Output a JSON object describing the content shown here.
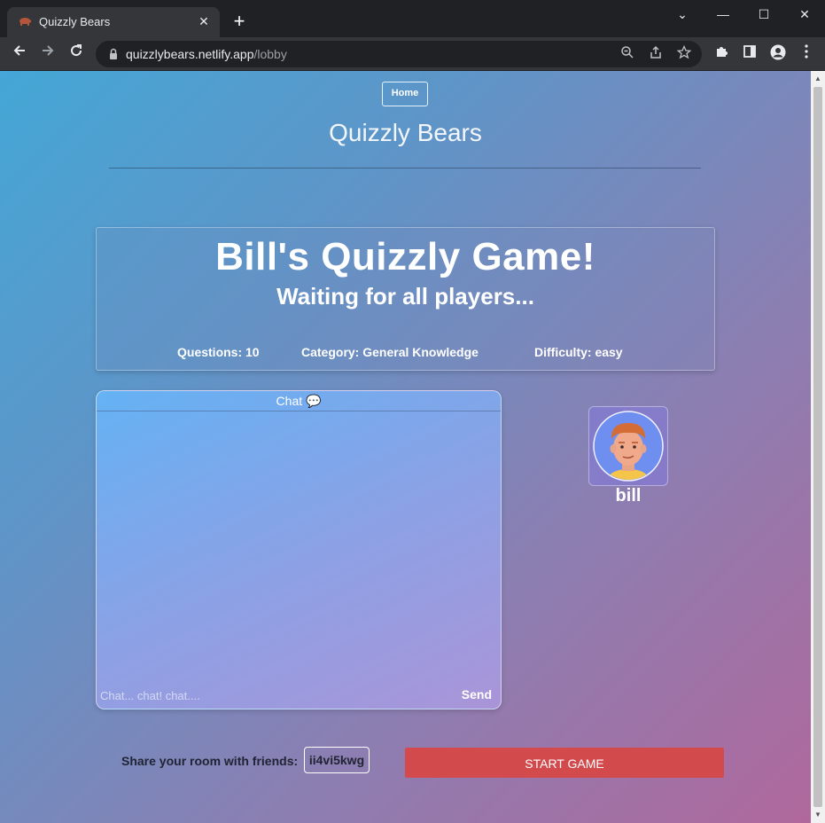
{
  "browser": {
    "tab_title": "Quizzly Bears",
    "tab_close": "✕",
    "new_tab": "+",
    "url_host": "quizzlybears.netlify.app",
    "url_path": "/lobby",
    "window_controls": {
      "chevron": "⌄",
      "minimize": "—",
      "maximize": "☐",
      "close": "✕"
    }
  },
  "nav": {
    "home_label": "Home"
  },
  "site": {
    "title": "Quizzly Bears"
  },
  "game": {
    "title": "Bill's Quizzly Game!",
    "subtitle": "Waiting for all players...",
    "questions": "Questions: 10",
    "category": "Category: General Knowledge",
    "difficulty": "Difficulty: easy"
  },
  "chat": {
    "header": "Chat 💬",
    "input_placeholder": "Chat... chat! chat....",
    "input_value": "",
    "send_label": "Send"
  },
  "players": [
    {
      "name": "bill",
      "avatar": "boy-avatar-icon"
    }
  ],
  "share": {
    "label": "Share your room with friends:",
    "room_code": "ii4vi5kwg"
  },
  "actions": {
    "start_label": "START GAME"
  },
  "colors": {
    "start_button": "#d34a4d",
    "gradient_start": "#44a7d6",
    "gradient_end": "#b0689c"
  }
}
